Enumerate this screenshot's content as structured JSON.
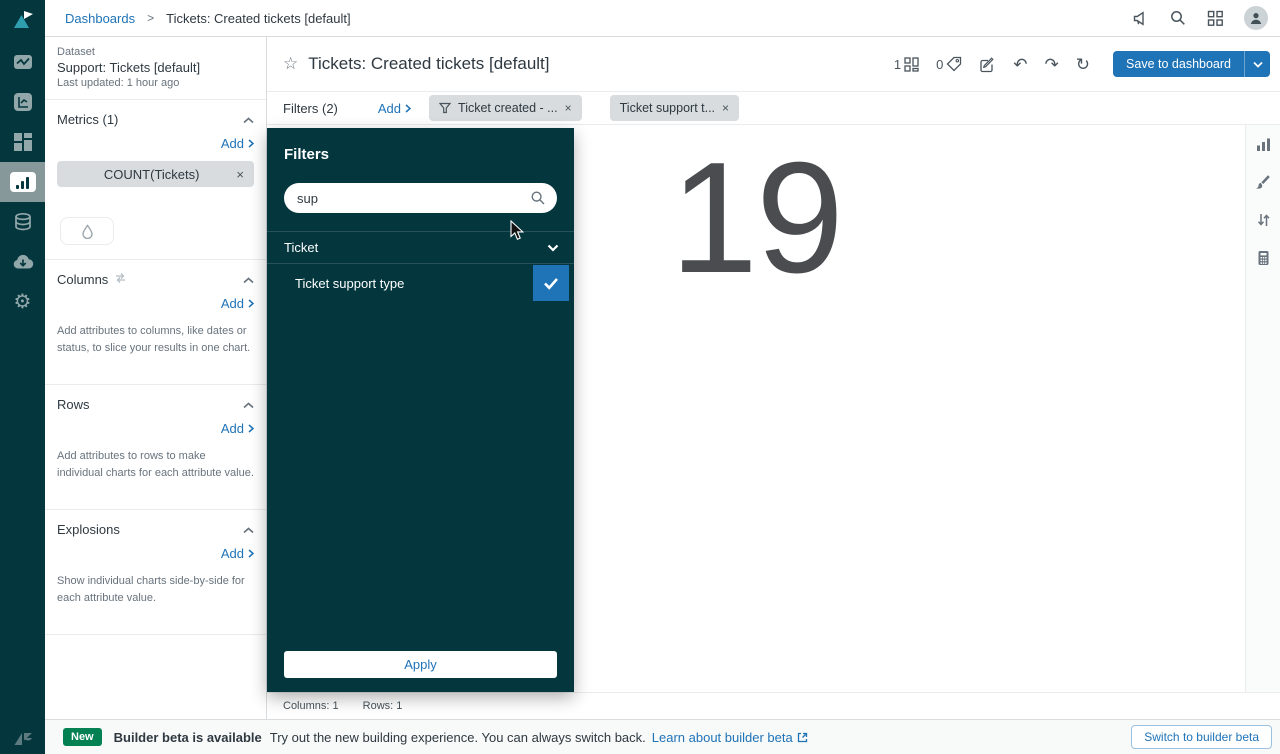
{
  "icons": {
    "gear": "⚙",
    "star": "☆",
    "undo": "↶",
    "redo": "↷",
    "refresh": "↻",
    "close": "×"
  },
  "topbar": {
    "breadcrumb_link": "Dashboards",
    "breadcrumb_separator": ">",
    "breadcrumb_current": "Tickets: Created tickets [default]"
  },
  "dataset": {
    "label": "Dataset",
    "name": "Support: Tickets [default]",
    "updated": "Last updated: 1 hour ago"
  },
  "builder": {
    "metrics": {
      "title": "Metrics (1)",
      "add": "Add",
      "chip": "COUNT(Tickets)"
    },
    "columns": {
      "title": "Columns",
      "add": "Add",
      "hint": "Add attributes to columns, like dates or status, to slice your results in one chart."
    },
    "rows": {
      "title": "Rows",
      "add": "Add",
      "hint": "Add attributes to rows to make individual charts for each attribute value."
    },
    "explosions": {
      "title": "Explosions",
      "add": "Add",
      "hint": "Show individual charts side-by-side for each attribute value."
    }
  },
  "query": {
    "title": "Tickets: Created tickets [default]",
    "dashboards_count": "1",
    "tags_count": "0",
    "save_label": "Save to dashboard"
  },
  "filters_bar": {
    "label": "Filters (2)",
    "add": "Add",
    "chips": [
      "Ticket created - ...",
      "Ticket support t..."
    ]
  },
  "popup": {
    "title": "Filters",
    "search_value": "sup",
    "group": "Ticket",
    "option": "Ticket support type",
    "apply": "Apply"
  },
  "result": {
    "value": "19"
  },
  "status": {
    "columns": "Columns: 1",
    "rows": "Rows: 1"
  },
  "footer": {
    "badge": "New",
    "title": "Builder beta is available",
    "description": "Try out the new building experience. You can always switch back.",
    "link": "Learn about builder beta",
    "button": "Switch to builder beta"
  },
  "colors": {
    "dark_teal": "#03363d",
    "accent_blue": "#1f73b7",
    "badge_green": "#038153",
    "chip_gray": "#d8dcde",
    "text_dark": "#2f3941",
    "text_muted": "#68737d"
  }
}
